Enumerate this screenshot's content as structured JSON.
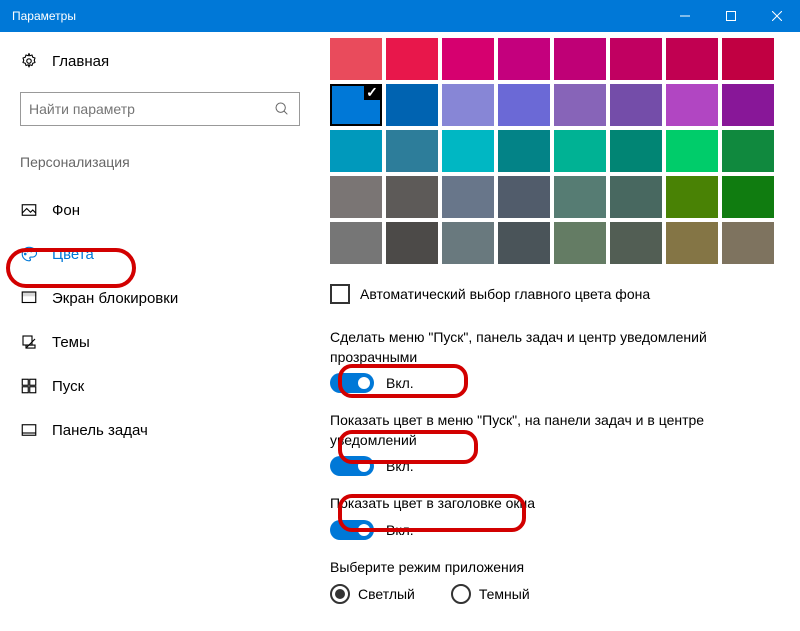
{
  "window": {
    "title": "Параметры"
  },
  "sidebar": {
    "home": "Главная",
    "search_placeholder": "Найти параметр",
    "category": "Персонализация",
    "items": [
      {
        "label": "Фон"
      },
      {
        "label": "Цвета"
      },
      {
        "label": "Экран блокировки"
      },
      {
        "label": "Темы"
      },
      {
        "label": "Пуск"
      },
      {
        "label": "Панель задач"
      }
    ]
  },
  "palette": {
    "colors": [
      "#e94b5c",
      "#e8174b",
      "#d6006f",
      "#c4007d",
      "#bf0076",
      "#c10061",
      "#c10051",
      "#c10042",
      "#0078d7",
      "#0063b1",
      "#8786d6",
      "#6b69d6",
      "#8764b8",
      "#744da9",
      "#b146c2",
      "#881798",
      "#0099bc",
      "#2d7d9a",
      "#00b7c3",
      "#038387",
      "#00b294",
      "#018574",
      "#00cc6a",
      "#10893e",
      "#7a7574",
      "#5d5a58",
      "#68768a",
      "#515c6b",
      "#567c73",
      "#486860",
      "#498205",
      "#107c10",
      "#767676",
      "#4c4a48",
      "#69797e",
      "#4a5459",
      "#647c64",
      "#525e54",
      "#847545",
      "#7e735f"
    ],
    "selected_index": 8
  },
  "auto_color": {
    "label": "Автоматический выбор главного цвета фона",
    "checked": false
  },
  "settings": [
    {
      "label": "Сделать меню \"Пуск\", панель задач и центр уведомлений прозрачными",
      "state": "Вкл."
    },
    {
      "label": "Показать цвет в меню \"Пуск\", на панели задач и в центре уведомлений",
      "state": "Вкл."
    },
    {
      "label": "Показать цвет в заголовке окна",
      "state": "Вкл."
    }
  ],
  "appmode": {
    "label": "Выберите режим приложения",
    "options": [
      "Светлый",
      "Темный"
    ],
    "selected": 0
  }
}
